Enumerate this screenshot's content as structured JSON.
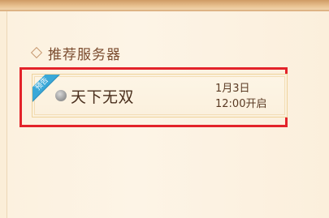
{
  "section": {
    "title": "推荐服务器",
    "icon": "diamond-icon"
  },
  "server": {
    "badge": "预告",
    "name": "天下无双",
    "status": "grey",
    "open_date": "1月3日",
    "open_time": "12:00开启"
  },
  "colors": {
    "badge": "#3aa8d8",
    "highlight": "#e3232a",
    "text": "#4a2f1d"
  }
}
